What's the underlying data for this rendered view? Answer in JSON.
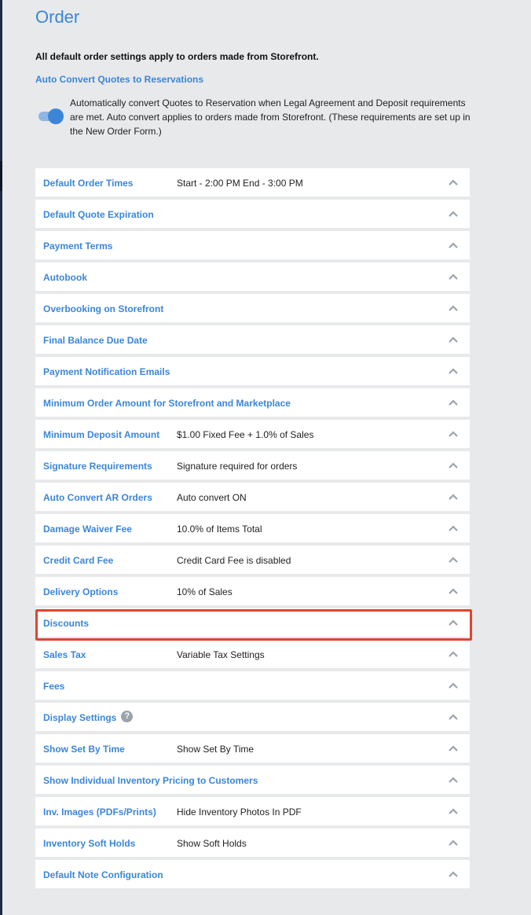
{
  "page": {
    "title": "Order",
    "intro": "All default order settings apply to orders made from Storefront.",
    "auto_convert": {
      "heading": "Auto Convert Quotes to Reservations",
      "toggle_on": true,
      "description": "Automatically convert Quotes to Reservation when Legal Agreement and Deposit requirements are met. Auto convert applies to orders made from Storefront. (These requirements are set up in the New Order Form.)"
    }
  },
  "colors": {
    "accent": "#3b86d8",
    "highlight": "#e0452f",
    "background": "#e8e9eb"
  },
  "settings": [
    {
      "label": "Default Order Times",
      "value": "Start - 2:00 PM End - 3:00 PM"
    },
    {
      "label": "Default Quote Expiration",
      "value": ""
    },
    {
      "label": "Payment Terms",
      "value": ""
    },
    {
      "label": "Autobook",
      "value": ""
    },
    {
      "label": "Overbooking on Storefront",
      "value": ""
    },
    {
      "label": "Final Balance Due Date",
      "value": ""
    },
    {
      "label": "Payment Notification Emails",
      "value": ""
    },
    {
      "label": "Minimum Order Amount for Storefront and Marketplace",
      "value": ""
    },
    {
      "label": "Minimum Deposit Amount",
      "value": "$1.00 Fixed Fee + 1.0% of Sales"
    },
    {
      "label": "Signature Requirements",
      "value": "Signature required for orders"
    },
    {
      "label": "Auto Convert AR Orders",
      "value": "Auto convert ON"
    },
    {
      "label": "Damage Waiver Fee",
      "value": "10.0% of Items Total"
    },
    {
      "label": "Credit Card Fee",
      "value": "Credit Card Fee is disabled"
    },
    {
      "label": "Delivery Options",
      "value": "10% of Sales"
    },
    {
      "label": "Discounts",
      "value": "",
      "highlighted": true
    },
    {
      "label": "Sales Tax",
      "value": "Variable Tax Settings"
    },
    {
      "label": "Fees",
      "value": ""
    },
    {
      "label": "Display Settings",
      "value": "",
      "help_icon": "?"
    },
    {
      "label": "Show Set By Time",
      "value": "Show Set By Time"
    },
    {
      "label": "Show Individual Inventory Pricing to Customers",
      "value": ""
    },
    {
      "label": "Inv. Images (PDFs/Prints)",
      "value": "Hide Inventory Photos In PDF"
    },
    {
      "label": "Inventory Soft Holds",
      "value": "Show Soft Holds"
    },
    {
      "label": "Default Note Configuration",
      "value": ""
    }
  ],
  "icons": {
    "row_toggle": "chevron-up-icon",
    "help": "help-icon"
  }
}
